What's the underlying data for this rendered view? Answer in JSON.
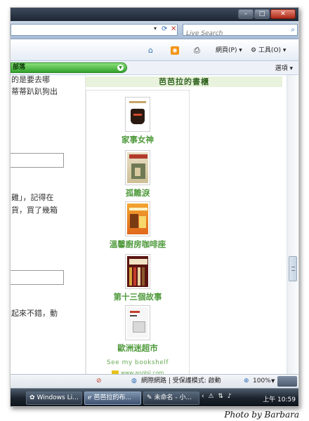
{
  "window": {
    "minimize": "–",
    "maximize": "□",
    "close": "✕"
  },
  "addressbar": {
    "dropdown": "▾",
    "refresh": "⟳",
    "stop": "✕"
  },
  "search": {
    "placeholder": "Live Search",
    "icon": "search-icon"
  },
  "commandbar": {
    "home": "⌂",
    "feeds": "◉",
    "print": "⎙",
    "page_label": "網頁(P) ▾",
    "tools_label": "⚙ 工具(O) ▾"
  },
  "tab": {
    "label": "部落",
    "options_label": "選項 ▾"
  },
  "page": {
    "left_text": [
      "的是要去哪",
      "蒂蒂趴趴狗出",
      "雞」，記得在",
      "貨，買了幾箱",
      "起來不錯，動"
    ],
    "bookshelf": {
      "header": "芭芭拉的書櫃",
      "books": [
        {
          "title": "家事女神",
          "cover_icon": "book-cover-icon"
        },
        {
          "title": "孤雛淚",
          "cover_icon": "book-cover-icon"
        },
        {
          "title": "溫馨廚房咖啡座",
          "cover_icon": "book-cover-icon"
        },
        {
          "title": "第十三個故事",
          "cover_icon": "book-cover-icon"
        },
        {
          "title": "歐洲迷超市",
          "cover_icon": "book-cover-icon"
        }
      ],
      "see_more": "See my bookshelf",
      "site": "www.anobii.com"
    }
  },
  "statusbar": {
    "zone": "網際網路 | 受保護模式: 啟動",
    "zoom": "100%"
  },
  "taskbar": {
    "tasks": [
      {
        "label": "Windows Li..."
      },
      {
        "label": "芭芭拉的布..."
      },
      {
        "label": "未命名 - 小..."
      }
    ],
    "clock": "上午 10:59"
  },
  "credit": "Photo by Barbara"
}
